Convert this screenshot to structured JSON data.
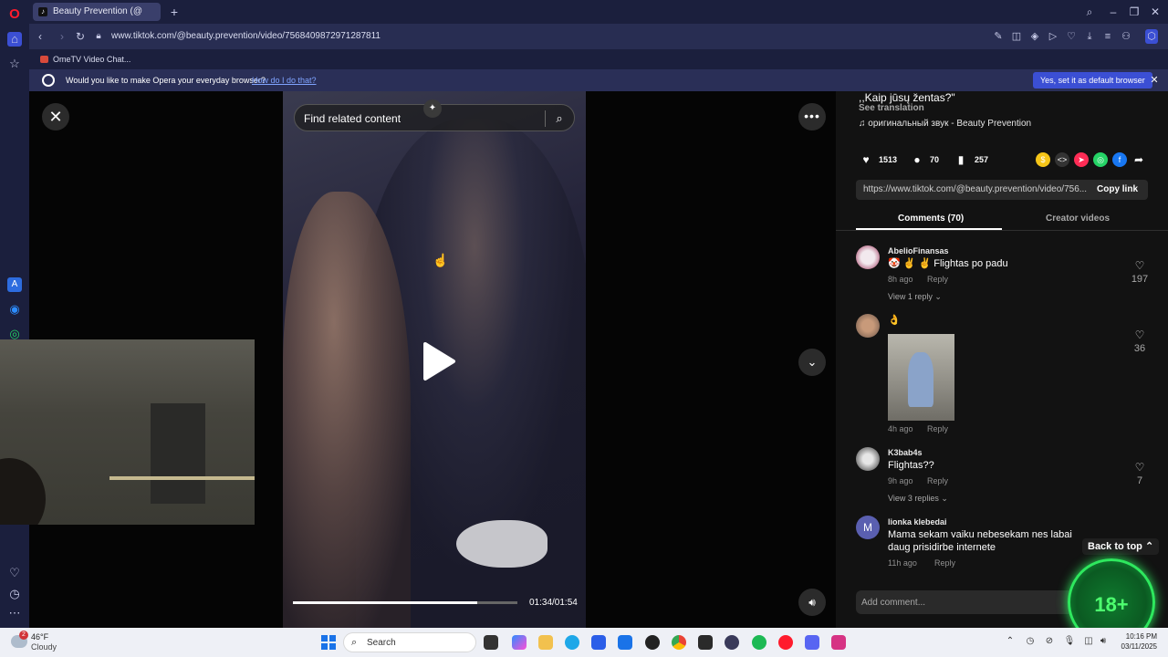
{
  "browser": {
    "tab_title": "Beauty Prevention (@",
    "url": "www.tiktok.com/@beauty.prevention/video/7568409872971287811",
    "bookmark": "OmeTV Video Chat...",
    "banner": {
      "text": "Would you like to make Opera your everyday browser?",
      "link": "How do I do that?",
      "button": "Yes, set it as default browser"
    }
  },
  "video": {
    "search_placeholder": "Find related content",
    "time": "01:34/01:54",
    "progress": 0.82
  },
  "post": {
    "description": ",,Kaip jūsų žentas?\"",
    "see_translation": "See translation",
    "sound": "оригинальный звук - Beauty Prevention",
    "likes": "1513",
    "comments": "70",
    "saves": "257",
    "link": "https://www.tiktok.com/@beauty.prevention/video/756...",
    "copy_link": "Copy link"
  },
  "tabs": {
    "comments": "Comments (70)",
    "creator": "Creator videos"
  },
  "comments": [
    {
      "user": "AbelioFinansas",
      "text": "🤡 ✌ ✌ Flightas po padu",
      "time": "8h ago",
      "reply": "Reply",
      "likes": "197",
      "view": "View 1 reply"
    },
    {
      "user": "",
      "text": "👌",
      "time": "4h ago",
      "reply": "Reply",
      "likes": "36"
    },
    {
      "user": "K3bab4s",
      "text": "Flightas??",
      "time": "9h ago",
      "reply": "Reply",
      "likes": "7",
      "view": "View 3 replies"
    },
    {
      "user": "lionka klebedai",
      "text": "Mama sekam vaiku nebesekam nes labai daug prisidirbe internete",
      "time": "11h ago",
      "reply": "Reply",
      "avatar_letter": "M"
    }
  ],
  "back_to_top": "Back to top",
  "add_comment_placeholder": "Add comment...",
  "badge": "18+",
  "taskbar": {
    "temp": "46°F",
    "condition": "Cloudy",
    "weather_badge": "2",
    "search": "Search",
    "time": "10:16 PM",
    "date": "03/11/2025"
  },
  "colors": {
    "opera_sidebar": "#1b1f3d",
    "banner_button": "#3b4fd4",
    "badge_green": "#2ee85e"
  }
}
